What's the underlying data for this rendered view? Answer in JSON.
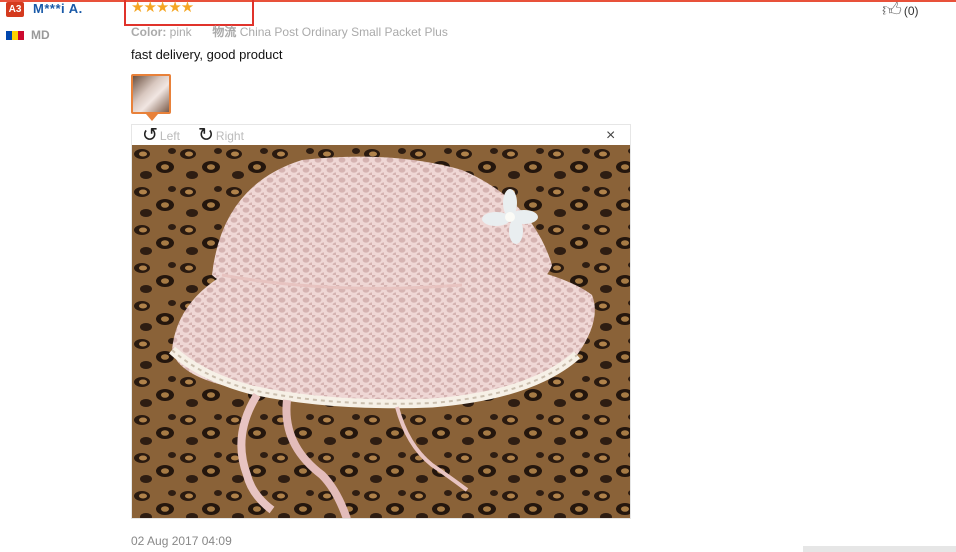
{
  "reviewer": {
    "level_badge": "A3",
    "name": "M***i A.",
    "country_code": "MD",
    "flag_colors": [
      "#0046ae",
      "#ffd200",
      "#cc092f"
    ]
  },
  "review": {
    "rating": 5,
    "stars_text": "★★★★★",
    "attributes": [
      {
        "label": "Color:",
        "value": "pink"
      },
      {
        "label": "物流",
        "value": "China Post Ordinary Small Packet Plus"
      }
    ],
    "text": "fast delivery, good product",
    "date": "02 Aug 2017 04:09",
    "helpful_count": "(0)"
  },
  "viewer": {
    "rotate_left_label": "Left",
    "rotate_right_label": "Right",
    "close_symbol": "×"
  },
  "icons": {
    "rotate_left": "rotate-left-icon",
    "rotate_right": "rotate-right-icon",
    "thumbs_up": "thumbs-up-icon",
    "close": "close-icon"
  },
  "colors": {
    "accent_red": "#e0332b",
    "star": "#f5a623",
    "name_blue": "#1a5aa8",
    "thumb_border": "#e8813a"
  }
}
